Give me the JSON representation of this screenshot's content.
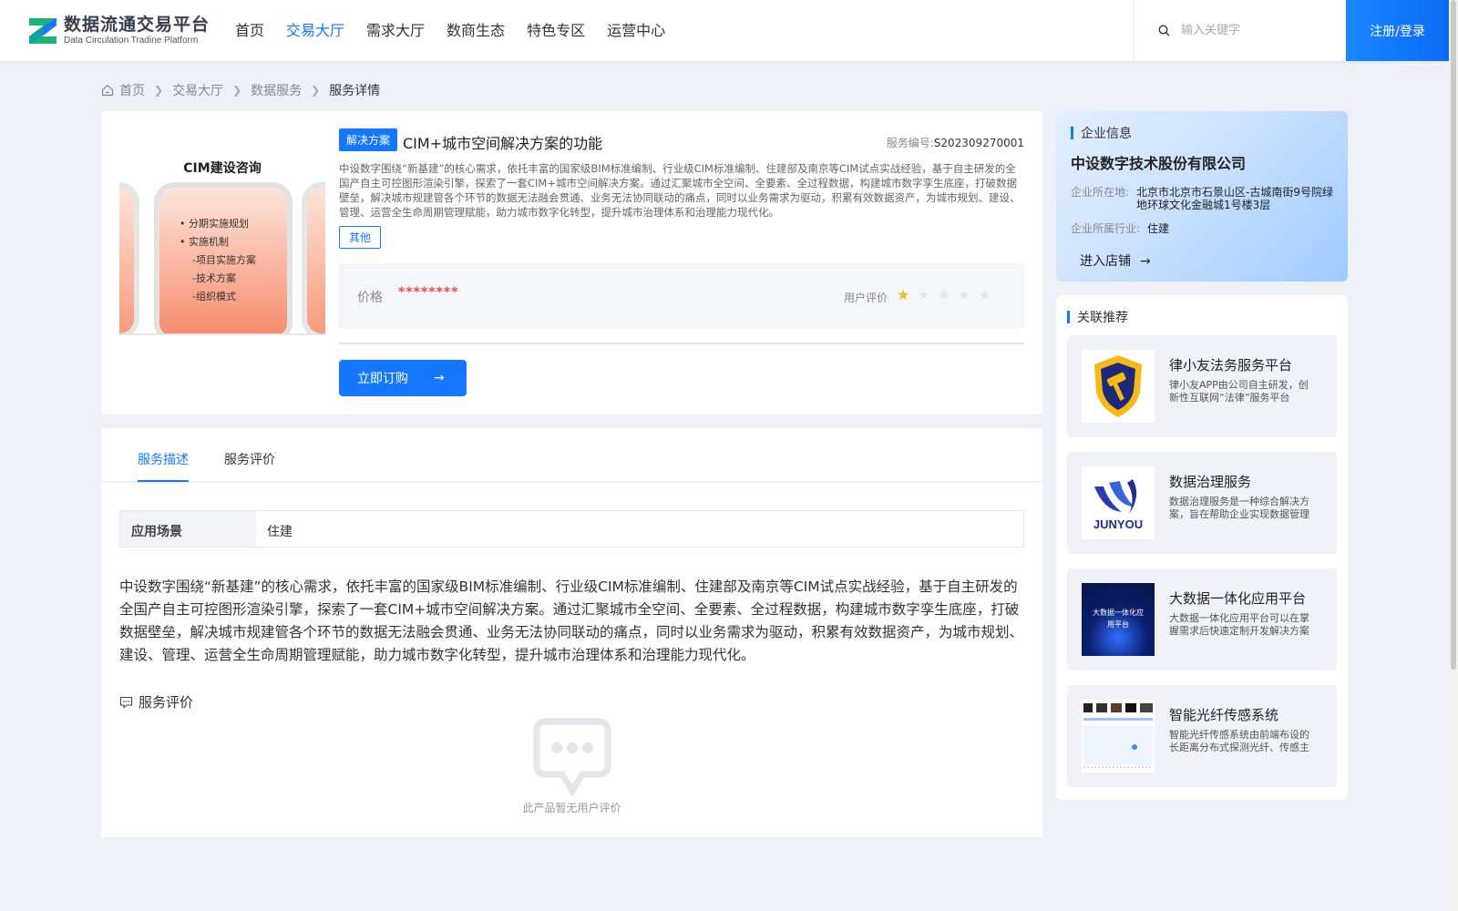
{
  "header": {
    "logo_cn": "数据流通交易平台",
    "logo_en": "Data Circulation Tradine Platform",
    "nav": [
      "首页",
      "交易大厅",
      "需求大厅",
      "数商生态",
      "特色专区",
      "运营中心"
    ],
    "active_nav": "交易大厅",
    "search_placeholder": "输入关键字",
    "login_label": "注册/登录"
  },
  "breadcrumb": {
    "home": "首页",
    "level1": "交易大厅",
    "level2": "数据服务",
    "current": "服务详情"
  },
  "product": {
    "thumb_title": "CIM建设咨询",
    "thumb_items": [
      "分期实施规划",
      "实施机制",
      "-项目实施方案",
      "-技术方案",
      "-组织模式"
    ],
    "tag": "解决方案",
    "title": "CIM+城市空间解决方案的功能",
    "service_no_label": "服务编号:",
    "service_no": "S202309270001",
    "description": "中设数字围绕“新基建”的核心需求，依托丰富的国家级BIM标准编制、行业级CIM标准编制、住建部及南京等CIM试点实战经验，基于自主研发的全国产自主可控图形渲染引擎，探索了一套CIM+城市空间解决方案。通过汇聚城市全空间、全要素、全过程数据，构建城市数字孪生底座，打破数据壁垒，解决城市规建管各个环节的数据无法融会贯通、业务无法协同联动的痛点，同时以业务需求为驱动，积累有效数据资产，为城市规划、建设、管理、运营全生命周期管理赋能，助力城市数字化转型，提升城市治理体系和治理能力现代化。",
    "category_tag": "其他",
    "price_label": "价格",
    "price": "********",
    "rating_label": "用户评价",
    "rating": 1,
    "rating_max": 5,
    "buy_label": "立即订购"
  },
  "detail": {
    "tabs": [
      "服务描述",
      "服务评价"
    ],
    "active_tab": "服务描述",
    "scene_key": "应用场景",
    "scene_value": "住建",
    "review_title": "服务评价",
    "empty_text": "此产品暂无用户评价"
  },
  "company": {
    "section_title": "企业信息",
    "name": "中设数字技术股份有限公司",
    "location_label": "企业所在地:",
    "location": "北京市北京市石景山区-古城南街9号院绿地环球文化金融城1号楼3层",
    "industry_label": "企业所属行业:",
    "industry": "住建",
    "enter_shop": "进入店铺"
  },
  "recommend": {
    "section_title": "关联推荐",
    "items": [
      {
        "name": "律小友法务服务平台",
        "desc": "律小友APP由公司自主研发，创新性互联网“法律”服务平台"
      },
      {
        "name": "数据治理服务",
        "desc": "数据治理服务是一种综合解决方案，旨在帮助企业实现数据管理"
      },
      {
        "name": "大数据一体化应用平台",
        "desc": "大数据一体化应用平台可以在掌握需求后快速定制开发解决方案",
        "img_text": "大数据一体化应用平台"
      },
      {
        "name": "智能光纤传感系统",
        "desc": "智能光纤传感系统由前端布设的长距离分布式探测光纤、传感主机"
      }
    ],
    "logo_text_2": "JUNYOU"
  },
  "colors": {
    "accent": "#1677ff",
    "price": "#f0484a",
    "star_on": "#f7b924",
    "background": "#eef0f7"
  }
}
